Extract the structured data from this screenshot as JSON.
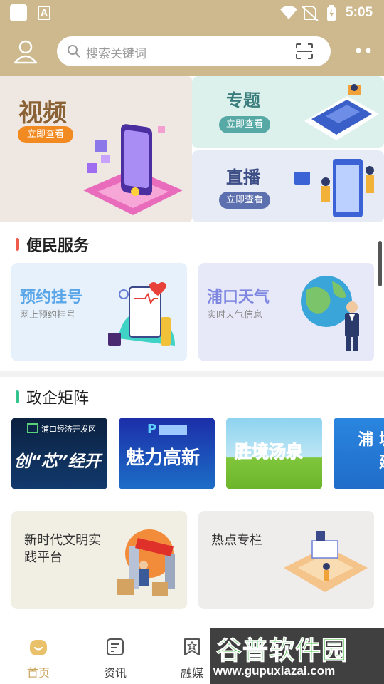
{
  "status_bar": {
    "time": "5:05",
    "app_icon_letter": "A"
  },
  "header": {
    "search_placeholder": "搜索关键词",
    "icons": [
      "user-icon",
      "search-icon",
      "scan-icon",
      "more-icon"
    ]
  },
  "banners": [
    {
      "title": "视频",
      "button": "立即查看"
    },
    {
      "title": "专题",
      "button": "立即查看"
    },
    {
      "title": "直播",
      "button": "立即查看"
    }
  ],
  "services": {
    "title": "便民服务",
    "accent": "#f05a4a",
    "items": [
      {
        "title": "预约挂号",
        "subtitle": "网上预约挂号",
        "color": "#5aa6e8"
      },
      {
        "title": "浦口天气",
        "subtitle": "实时天气信息",
        "color": "#7d86e0"
      }
    ]
  },
  "matrix": {
    "title": "政企矩阵",
    "accent": "#31c48d",
    "items": [
      {
        "label": "创“芯”经开",
        "tag": "浦口经济开发区"
      },
      {
        "label": "魅力高新",
        "tag": "P"
      },
      {
        "label": "胜境汤泉"
      },
      {
        "label": "浦 城建"
      }
    ]
  },
  "features": [
    {
      "title": "新时代文明实践平台"
    },
    {
      "title": "热点专栏"
    }
  ],
  "bottom_nav": [
    {
      "label": "首页",
      "icon": "home-icon",
      "active": true
    },
    {
      "label": "资讯",
      "icon": "news-icon",
      "active": false
    },
    {
      "label": "融媒",
      "icon": "media-icon",
      "active": false
    }
  ],
  "watermark": {
    "cn": "谷普软件园",
    "url": "www.gupuxiazai.com"
  }
}
